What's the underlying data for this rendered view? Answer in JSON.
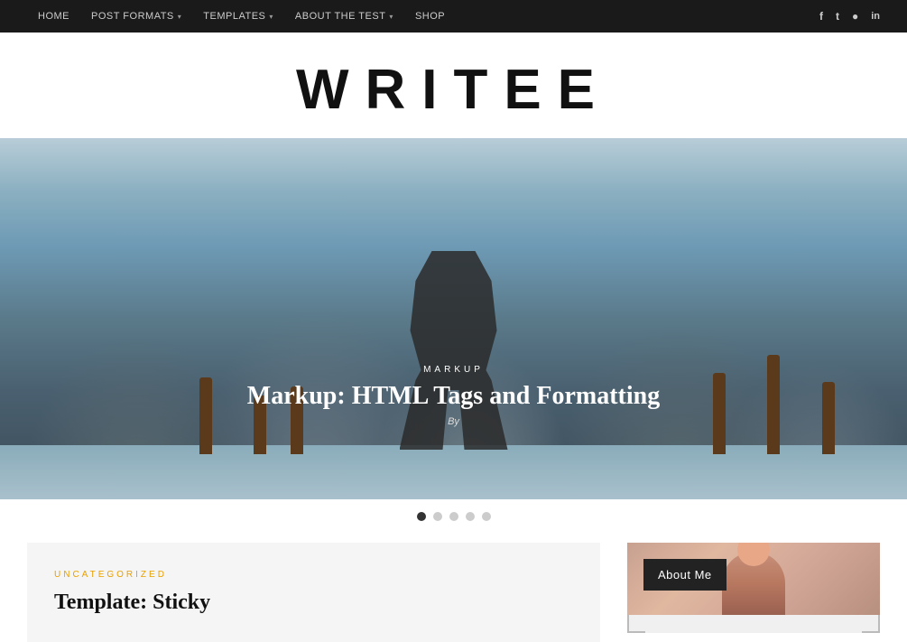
{
  "nav": {
    "links": [
      {
        "label": "HOME",
        "hasDropdown": false
      },
      {
        "label": "POST FORMATS",
        "hasDropdown": true
      },
      {
        "label": "TEMPLATES",
        "hasDropdown": true
      },
      {
        "label": "ABOUT THE TEST",
        "hasDropdown": true
      },
      {
        "label": "SHOP",
        "hasDropdown": false
      }
    ],
    "social": [
      {
        "name": "facebook",
        "icon": "f"
      },
      {
        "name": "twitter",
        "icon": "t"
      },
      {
        "name": "instagram",
        "icon": "i"
      },
      {
        "name": "linkedin",
        "icon": "in"
      }
    ]
  },
  "site": {
    "title": "WRITEE"
  },
  "hero": {
    "category": "MARKUP",
    "title": "Markup: HTML Tags and Formatting",
    "by": "By"
  },
  "slider": {
    "dots": [
      {
        "active": true
      },
      {
        "active": false
      },
      {
        "active": false
      },
      {
        "active": false
      },
      {
        "active": false
      }
    ]
  },
  "article": {
    "category": "UNCATEGORIZED",
    "title": "Template: Sticky"
  },
  "sidebar": {
    "about_me_label": "About Me"
  },
  "icons": {
    "facebook": "f",
    "twitter": "𝕋",
    "instagram": "📷",
    "linkedin": "in"
  }
}
